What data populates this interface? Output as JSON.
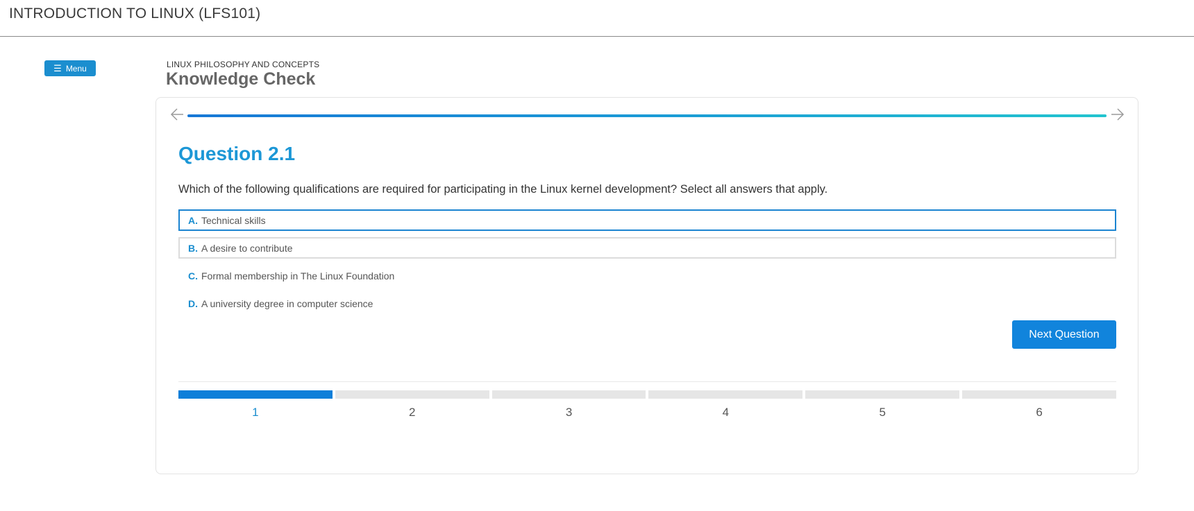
{
  "header": {
    "course_title": "INTRODUCTION TO LINUX (LFS101)"
  },
  "menu": {
    "icon": "hamburger-icon",
    "label": "Menu"
  },
  "breadcrumb": {
    "section": "LINUX PHILOSOPHY AND CONCEPTS",
    "title": "Knowledge Check"
  },
  "navigation": {
    "prev_icon": "arrow-left-icon",
    "next_icon": "arrow-right-icon",
    "progress": 1.0
  },
  "question": {
    "title": "Question 2.1",
    "text": "Which of the following qualifications are required for participating in the Linux kernel development? Select all answers that apply.",
    "options": [
      {
        "letter": "A.",
        "text": "Technical skills",
        "state": "selected"
      },
      {
        "letter": "B.",
        "text": "A desire to contribute",
        "state": "hover"
      },
      {
        "letter": "C.",
        "text": "Formal membership in The Linux Foundation",
        "state": "default"
      },
      {
        "letter": "D.",
        "text": "A university degree in computer science",
        "state": "default"
      }
    ]
  },
  "next_button": {
    "label": "Next Question"
  },
  "steps": {
    "current": 1,
    "items": [
      "1",
      "2",
      "3",
      "4",
      "5",
      "6"
    ]
  },
  "colors": {
    "accent": "#1b8ecf",
    "question_title": "#1c97d6",
    "button": "#1184dc",
    "progress_start": "#1778d6",
    "progress_end": "#22c4cf"
  }
}
